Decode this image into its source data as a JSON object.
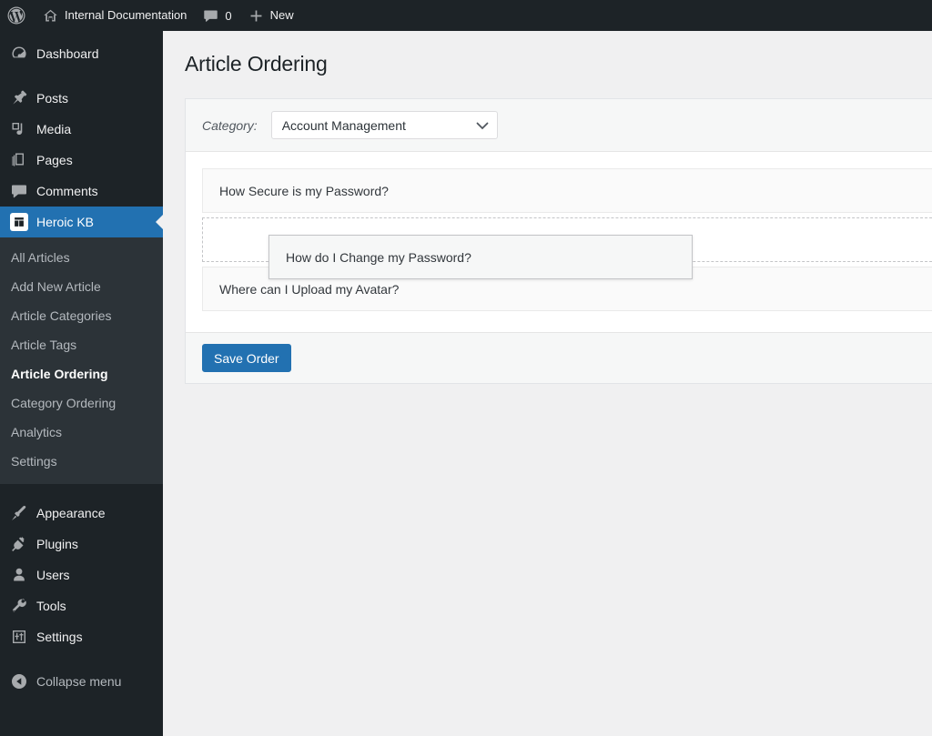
{
  "adminbar": {
    "logo_icon": "wordpress-logo-icon",
    "site": {
      "icon": "home-icon",
      "label": "Internal Documentation"
    },
    "comments": {
      "icon": "comment-bubble-icon",
      "count": "0"
    },
    "new": {
      "icon": "plus-icon",
      "label": "New"
    }
  },
  "sidebar": {
    "top_items": [
      {
        "label": "Dashboard",
        "icon": "dashboard-gauge-icon",
        "name": "dashboard"
      },
      {
        "label": "Posts",
        "icon": "pin-icon",
        "name": "posts"
      },
      {
        "label": "Media",
        "icon": "media-photo-icon",
        "name": "media"
      },
      {
        "label": "Pages",
        "icon": "pages-icon",
        "name": "pages"
      },
      {
        "label": "Comments",
        "icon": "comment-bubble-icon",
        "name": "comments"
      },
      {
        "label": "Heroic KB",
        "icon": "heroic-kb-book-icon",
        "name": "heroic-kb",
        "active": true
      }
    ],
    "submenu": [
      {
        "label": "All Articles",
        "name": "all-articles"
      },
      {
        "label": "Add New Article",
        "name": "add-new-article"
      },
      {
        "label": "Article Categories",
        "name": "article-categories"
      },
      {
        "label": "Article Tags",
        "name": "article-tags"
      },
      {
        "label": "Article Ordering",
        "name": "article-ordering",
        "current": true
      },
      {
        "label": "Category Ordering",
        "name": "category-ordering"
      },
      {
        "label": "Analytics",
        "name": "analytics"
      },
      {
        "label": "Settings",
        "name": "settings"
      }
    ],
    "bottom_items": [
      {
        "label": "Appearance",
        "icon": "paintbrush-icon",
        "name": "appearance"
      },
      {
        "label": "Plugins",
        "icon": "plug-icon",
        "name": "plugins"
      },
      {
        "label": "Users",
        "icon": "user-icon",
        "name": "users"
      },
      {
        "label": "Tools",
        "icon": "wrench-icon",
        "name": "tools"
      },
      {
        "label": "Settings",
        "icon": "sliders-icon",
        "name": "settings"
      }
    ],
    "collapse": {
      "label": "Collapse menu",
      "icon": "arrow-left-circle-icon"
    }
  },
  "main": {
    "page_title": "Article Ordering",
    "category_label": "Category:",
    "category_selected": "Account Management",
    "category_chevron_icon": "chevron-down-icon",
    "items": [
      {
        "label": "How Secure is my Password?",
        "state": "normal"
      },
      {
        "label": "",
        "state": "placeholder"
      },
      {
        "label": "How do I Change my Password?",
        "state": "dragging"
      },
      {
        "label": "Where can I Upload my Avatar?",
        "state": "normal"
      }
    ],
    "save_label": "Save Order"
  },
  "colors": {
    "adminbar_bg": "#1d2327",
    "sidebar_bg": "#1d2327",
    "submenu_bg": "#2c3338",
    "accent_blue": "#2271b1",
    "content_bg": "#f0f0f1",
    "panel_bg": "#ffffff",
    "panel_chrome_bg": "#f6f7f7",
    "item_bg": "#fafafa",
    "text_dark": "#1d2327",
    "text_muted": "#b4b9be"
  }
}
